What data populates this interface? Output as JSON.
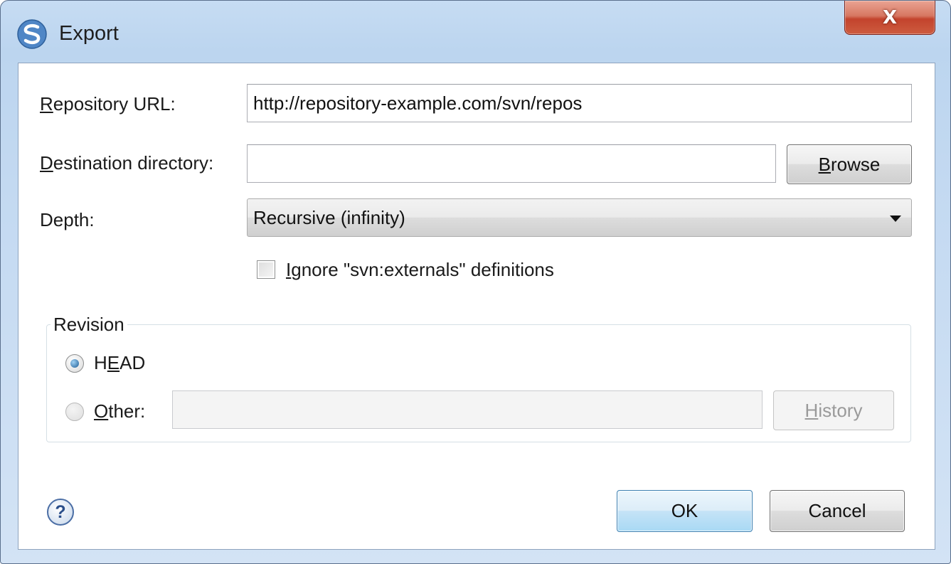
{
  "window": {
    "title": "Export",
    "close_label": "X"
  },
  "form": {
    "repository_url": {
      "label_hotkey": "R",
      "label_rest": "epository URL:",
      "value": "http://repository-example.com/svn/repos"
    },
    "destination": {
      "label_hotkey": "D",
      "label_rest": "estination directory:",
      "value": ""
    },
    "browse": {
      "label_hotkey": "B",
      "label_rest": "rowse"
    },
    "depth": {
      "label": "Depth:",
      "selected": "Recursive (infinity)"
    },
    "ignore_externals": {
      "label_hotkey": "I",
      "label_rest": "gnore \"svn:externals\" definitions",
      "checked": false
    }
  },
  "revision": {
    "title": "Revision",
    "head": {
      "label_pre": "H",
      "label_hotkey": "E",
      "label_post": "AD",
      "checked": true
    },
    "other": {
      "label_hotkey": "O",
      "label_rest": "ther:",
      "value": "",
      "checked": false
    },
    "history": {
      "label_hotkey": "H",
      "label_rest": "istory"
    }
  },
  "footer": {
    "help_glyph": "?",
    "ok_label": "OK",
    "cancel_label": "Cancel"
  },
  "icons": {
    "app": "svn-logo-icon",
    "close": "close-icon",
    "help": "help-icon",
    "dropdown": "chevron-down-icon"
  }
}
